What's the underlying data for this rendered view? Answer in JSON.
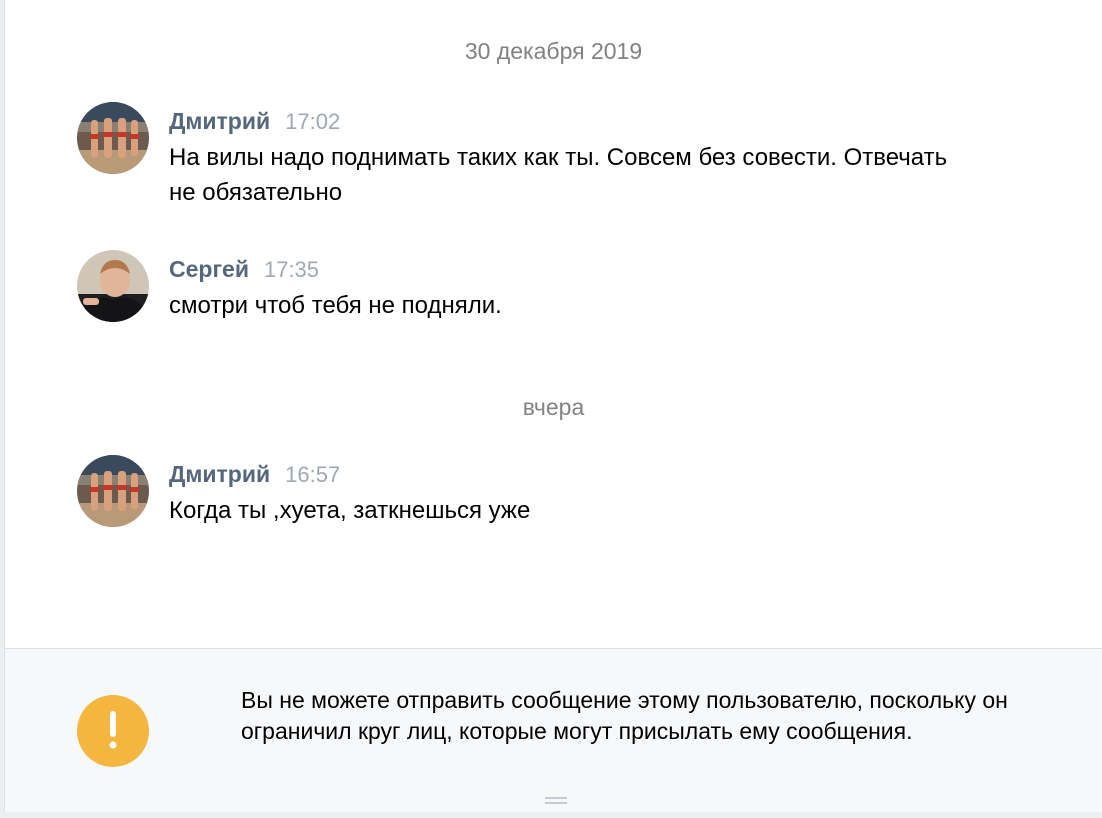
{
  "dividers": {
    "first": "30 декабря 2019",
    "second": "вчера"
  },
  "messages": [
    {
      "author": "Дмитрий",
      "time": "17:02",
      "text": "На вилы надо поднимать таких как ты. Совсем без совести. Отвечать не обязательно",
      "avatar": "beach-volleyball-photo"
    },
    {
      "author": "Сергей",
      "time": "17:35",
      "text": "смотри чтоб тебя не подняли.",
      "avatar": "man-photo"
    },
    {
      "author": "Дмитрий",
      "time": "16:57",
      "text": "Когда ты ,хуета, заткнешься уже",
      "avatar": "beach-volleyball-photo"
    }
  ],
  "composer": {
    "notice": "Вы не можете отправить сообщение этому пользователю, поскольку он ограничил круг лиц, которые могут присылать ему сообщения.",
    "icon": "exclamation-icon"
  },
  "colors": {
    "author": "#55677d",
    "time": "#a0a8b1",
    "divider_text": "#828282",
    "warning": "#f4b63f",
    "composer_bg": "#f7f8fa"
  }
}
